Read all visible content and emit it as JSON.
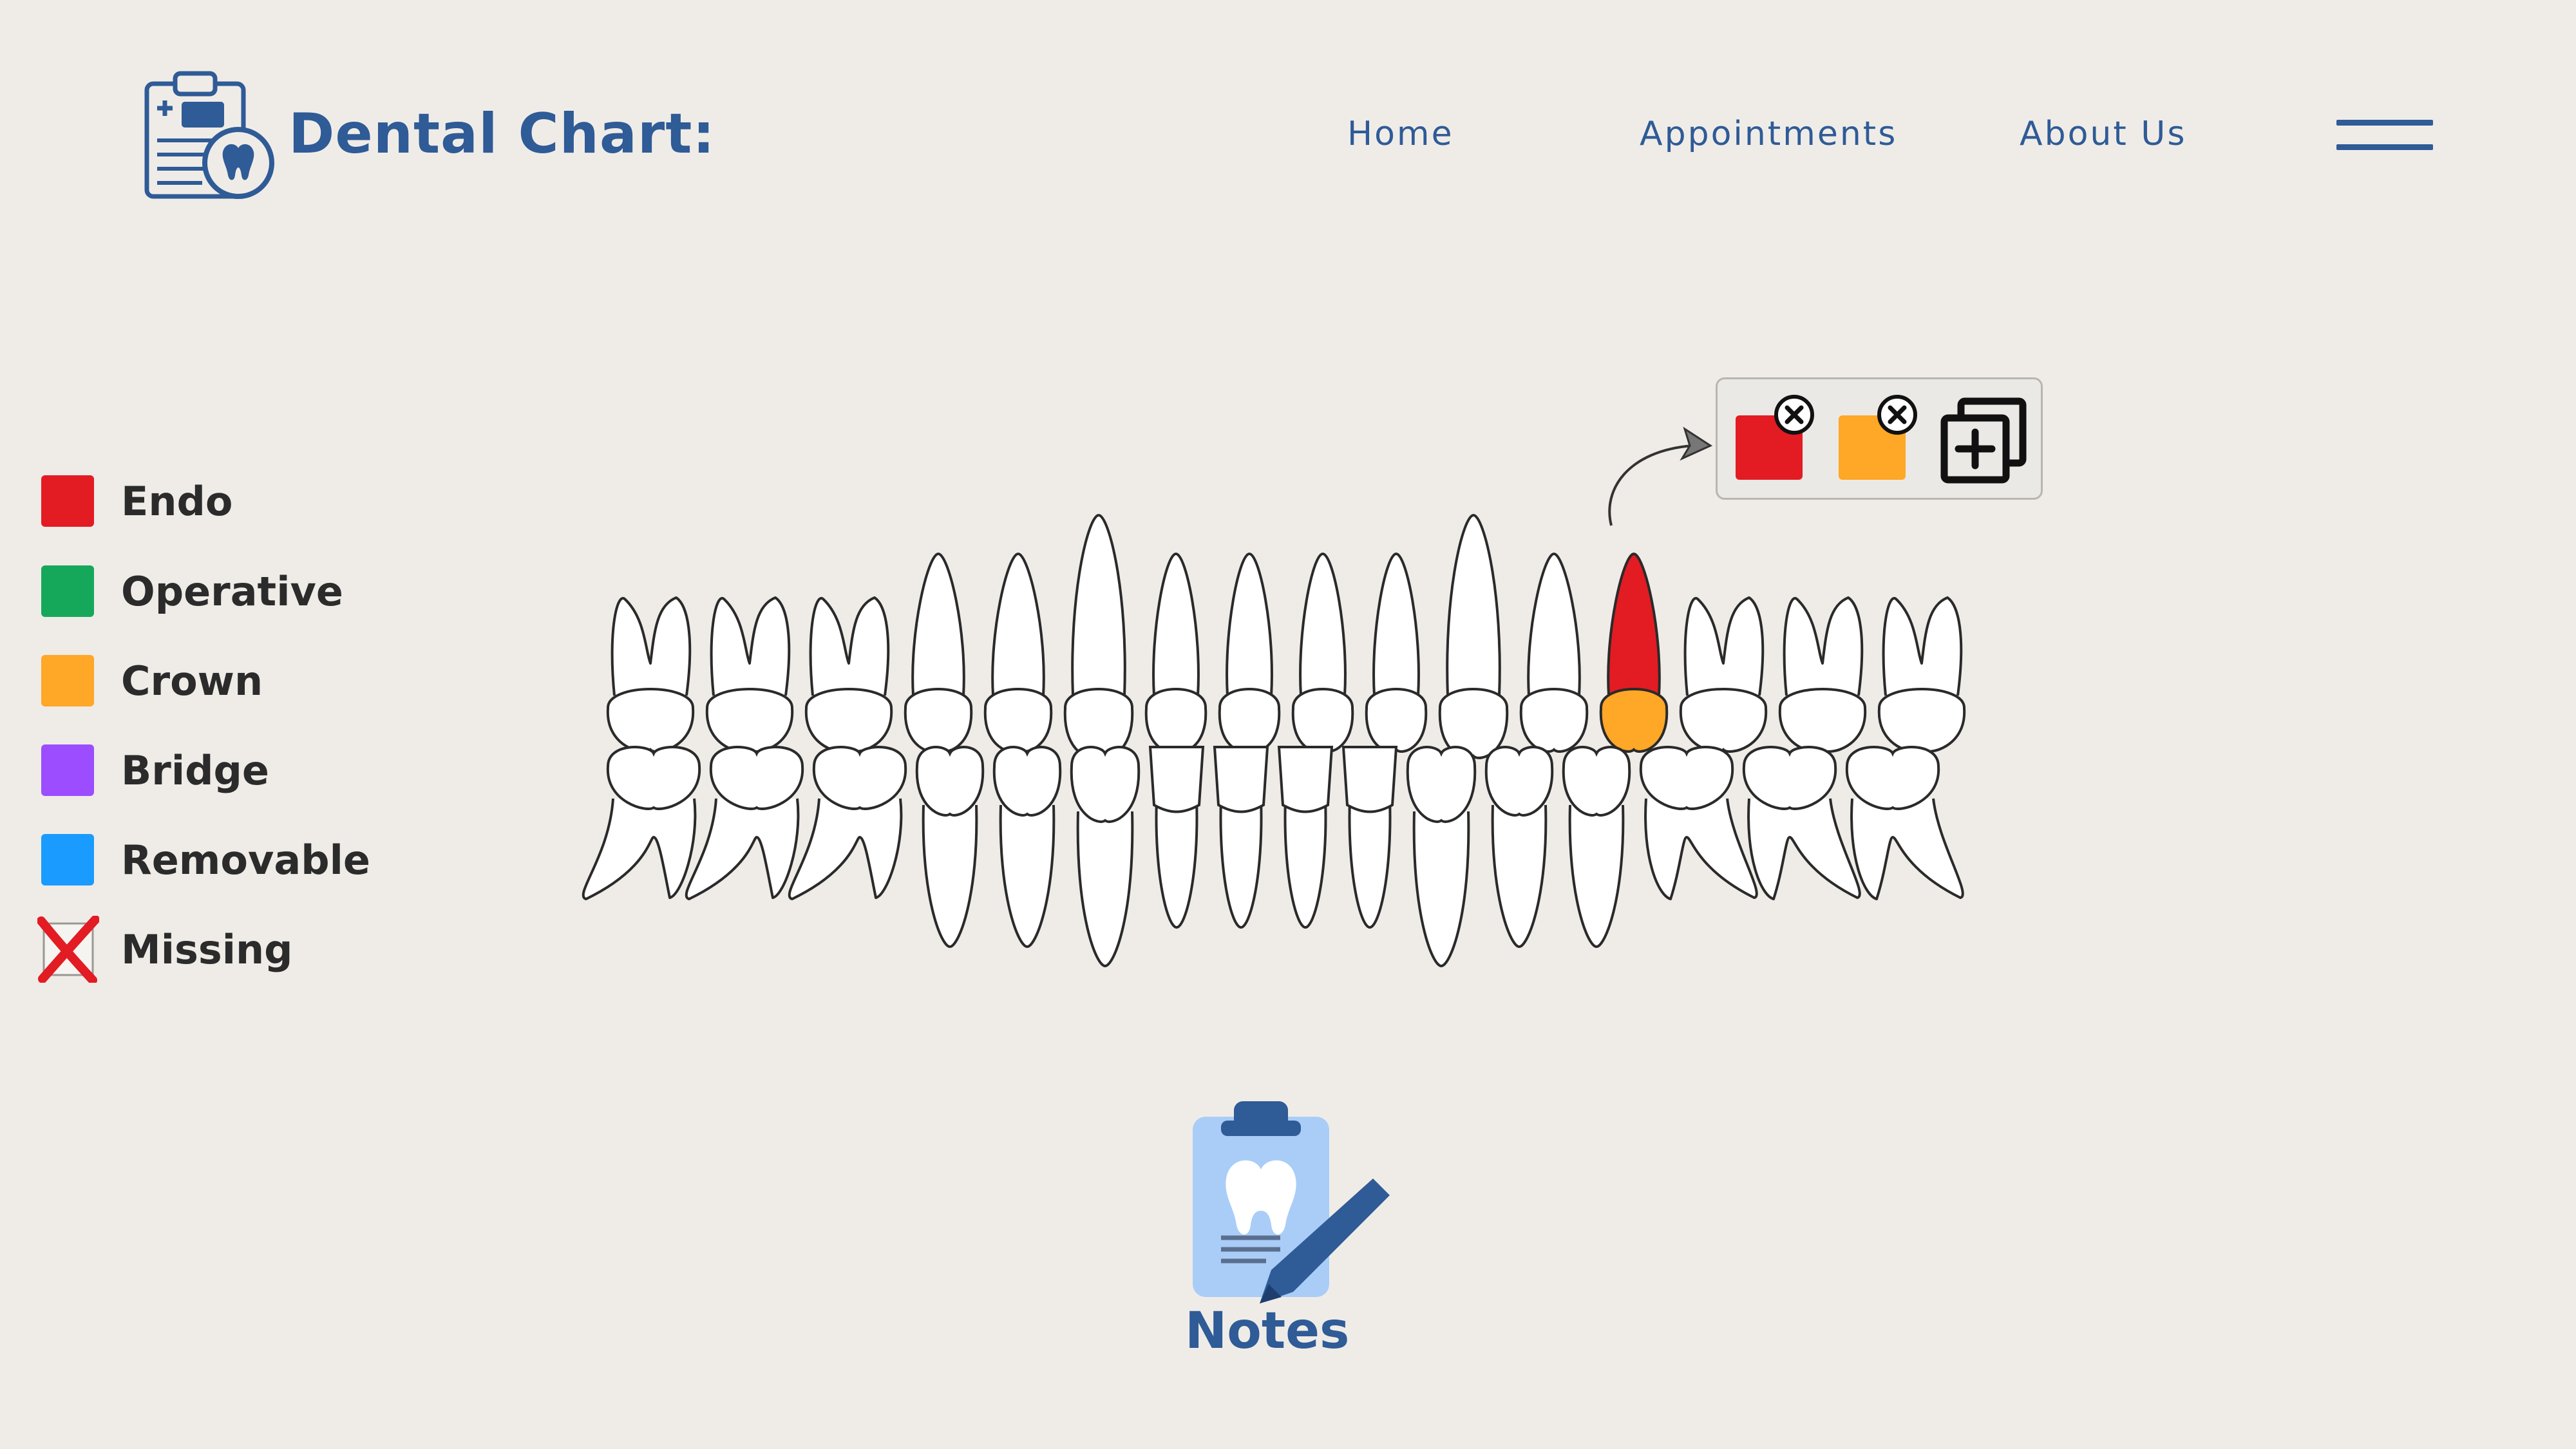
{
  "header": {
    "brand_title": "Dental Chart:",
    "nav": [
      {
        "label": "Home"
      },
      {
        "label": "Appointments"
      },
      {
        "label": "About Us"
      }
    ],
    "menu_icon": "hamburger-icon",
    "logo_icon": "clipboard-tooth-icon"
  },
  "legend": {
    "items": [
      {
        "label": "Endo",
        "color": "#e31b23"
      },
      {
        "label": "Operative",
        "color": "#16a85a"
      },
      {
        "label": "Crown",
        "color": "#ffa726"
      },
      {
        "label": "Bridge",
        "color": "#9b4dff"
      },
      {
        "label": "Removable",
        "color": "#1a9bff"
      },
      {
        "label": "Missing",
        "color": "#e31b23",
        "icon": "red-x-icon"
      }
    ]
  },
  "chart": {
    "upper_teeth": 16,
    "lower_teeth": 16,
    "selected_tooth": {
      "arch": "upper",
      "index": 12,
      "conditions": [
        "Endo",
        "Crown"
      ]
    }
  },
  "popup": {
    "applied": [
      {
        "condition": "Endo",
        "color": "#e31b23"
      },
      {
        "condition": "Crown",
        "color": "#ffa726"
      }
    ],
    "remove_icon": "circle-x-icon",
    "add_icon": "add-copy-icon"
  },
  "notes": {
    "label": "Notes",
    "icon": "clipboard-pen-icon"
  },
  "colors": {
    "brand": "#2f5b96",
    "background": "#efece8"
  }
}
